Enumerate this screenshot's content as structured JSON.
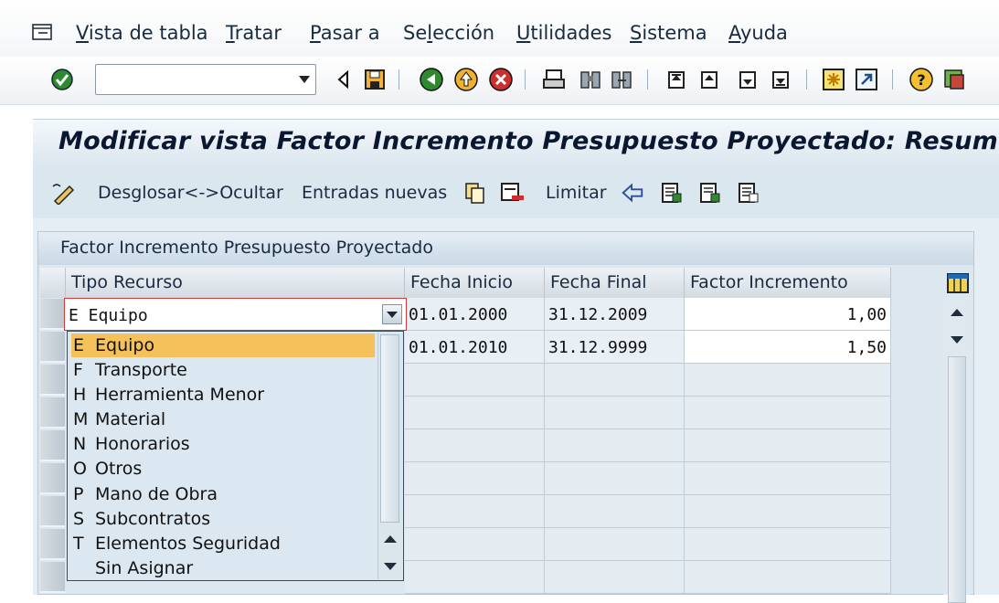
{
  "menu": {
    "items": [
      {
        "u": "V",
        "rest": "ista de tabla"
      },
      {
        "u": "T",
        "rest": "ratar"
      },
      {
        "u": "P",
        "rest": "asar a"
      },
      {
        "pre": "Se",
        "u": "l",
        "rest": "ección"
      },
      {
        "u": "U",
        "rest": "tilidades"
      },
      {
        "u": "S",
        "rest": "istema"
      },
      {
        "u": "A",
        "rest": "yuda"
      }
    ]
  },
  "command_field": {
    "value": ""
  },
  "title": "Modificar vista Factor Incremento Presupuesto Proyectado: Resumen",
  "app_toolbar": {
    "details_label": "Desglosar<->Ocultar",
    "new_entries_label": "Entradas nuevas",
    "limit_label": "Limitar"
  },
  "table": {
    "title": "Factor Incremento Presupuesto Proyectado",
    "columns": [
      "Tipo Recurso",
      "Fecha Inicio",
      "Fecha Final",
      "Factor Incremento"
    ],
    "rows": [
      {
        "tipo": "E Equipo",
        "inicio": "01.01.2000",
        "final": "31.12.2009",
        "factor": "1,00"
      },
      {
        "tipo": "",
        "inicio": "01.01.2010",
        "final": "31.12.9999",
        "factor": "1,50"
      }
    ]
  },
  "dropdown": {
    "selected_index": 0,
    "options": [
      {
        "key": "E",
        "text": "Equipo"
      },
      {
        "key": "F",
        "text": "Transporte"
      },
      {
        "key": "H",
        "text": "Herramienta Menor"
      },
      {
        "key": "M",
        "text": "Material"
      },
      {
        "key": "N",
        "text": "Honorarios"
      },
      {
        "key": "O",
        "text": "Otros"
      },
      {
        "key": "P",
        "text": "Mano de Obra"
      },
      {
        "key": "S",
        "text": "Subcontratos"
      },
      {
        "key": "T",
        "text": "Elementos Seguridad"
      },
      {
        "key": "",
        "text": "Sin Asignar"
      }
    ]
  },
  "colors": {
    "selection": "#f5c15b",
    "accent_red": "#cc3b3b",
    "title_text": "#0a1730"
  }
}
